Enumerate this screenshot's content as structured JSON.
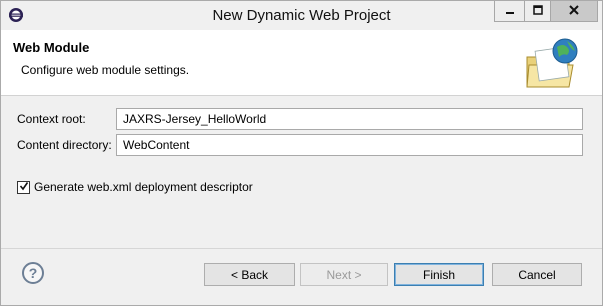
{
  "window": {
    "title": "New Dynamic Web Project",
    "icon": "eclipse-icon",
    "controls": [
      "minimize-icon",
      "maximize-icon",
      "close-icon"
    ]
  },
  "header": {
    "title": "Web Module",
    "description": "Configure web module settings.",
    "banner_icon": "web-folder-globe-icon"
  },
  "form": {
    "context_root_label": "Context root:",
    "context_root_value": "JAXRS-Jersey_HelloWorld",
    "content_dir_label": "Content directory:",
    "content_dir_value": "WebContent",
    "generate_xml_label": "Generate web.xml deployment descriptor",
    "generate_xml_checked": true
  },
  "footer": {
    "help_label": "?",
    "back_label": "< Back",
    "next_label": "Next >",
    "finish_label": "Finish",
    "cancel_label": "Cancel"
  },
  "colors": {
    "accent": "#3c7fb1",
    "header_bg": "#ffffff",
    "dialog_bg": "#f0f0f0"
  }
}
